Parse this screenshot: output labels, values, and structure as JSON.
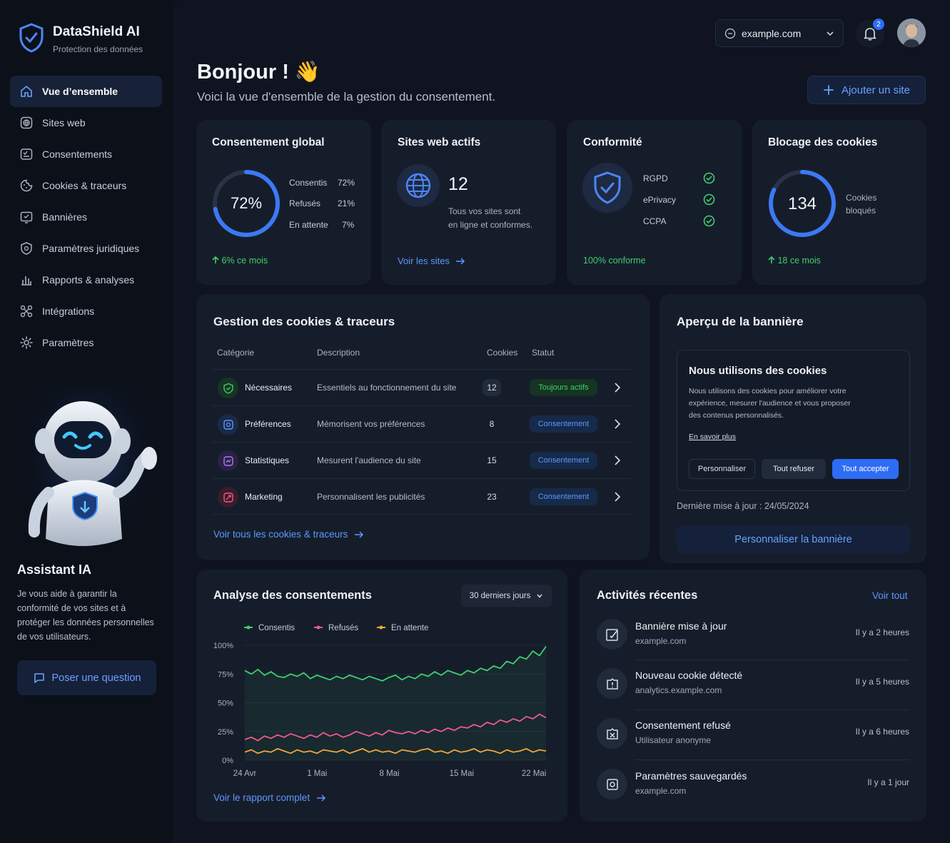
{
  "app": {
    "name": "DataShield AI",
    "tagline": "Protection des données"
  },
  "nav": [
    {
      "label": "Vue d’ensemble",
      "icon": "home-icon",
      "active": true
    },
    {
      "label": "Sites web",
      "icon": "globe-icon"
    },
    {
      "label": "Consentements",
      "icon": "consent-icon"
    },
    {
      "label": "Cookies & traceurs",
      "icon": "cookie-icon"
    },
    {
      "label": "Bannières",
      "icon": "banner-icon"
    },
    {
      "label": "Paramètres juridiques",
      "icon": "legal-icon"
    },
    {
      "label": "Rapports & analyses",
      "icon": "chart-icon"
    },
    {
      "label": "Intégrations",
      "icon": "integrations-icon"
    },
    {
      "label": "Paramètres",
      "icon": "gear-icon"
    }
  ],
  "assistant": {
    "title": "Assistant IA",
    "text": "Je vous aide à garantir la conformité de vos sites et à protéger les données personnelles de vos utilisateurs.",
    "button": "Poser une question"
  },
  "topbar": {
    "site": "example.com",
    "notifications": "2"
  },
  "greeting": {
    "title": "Bonjour ! 👋",
    "subtitle": "Voici la vue d'ensemble de la gestion du consentement.",
    "add_site": "Ajouter un site"
  },
  "stats": {
    "consent": {
      "title": "Consentement global",
      "value": "72%",
      "fraction": 0.72,
      "rows": [
        {
          "label": "Consentis",
          "value": "72%"
        },
        {
          "label": "Refusés",
          "value": "21%"
        },
        {
          "label": "En attente",
          "value": "7%"
        }
      ],
      "trend": "6% ce mois"
    },
    "sites": {
      "title": "Sites web actifs",
      "value": "12",
      "text1": "Tous vos sites sont",
      "text2": "en ligne et conformes.",
      "link": "Voir les sites"
    },
    "compliance": {
      "title": "Conformité",
      "items": [
        "RGPD",
        "ePrivacy",
        "CCPA"
      ],
      "footer": "100% conforme"
    },
    "blocking": {
      "title": "Blocage des cookies",
      "value": "134",
      "label1": "Cookies",
      "label2": "bloqués",
      "trend": "18 ce mois",
      "fraction": 0.82
    }
  },
  "cookies": {
    "title": "Gestion des cookies & traceurs",
    "headers": {
      "category": "Catégorie",
      "description": "Description",
      "count": "Cookies",
      "status": "Statut"
    },
    "rows": [
      {
        "category": "Nécessaires",
        "description": "Essentiels au fonctionnement du site",
        "count": "12",
        "status": "Toujours actifs",
        "color": "#3ecf6e"
      },
      {
        "category": "Préférences",
        "description": "Mémorisent vos préférences",
        "count": "8",
        "status": "Consentement",
        "color": "#5c98ff"
      },
      {
        "category": "Statistiques",
        "description": "Mesurent l'audience du site",
        "count": "15",
        "status": "Consentement",
        "color": "#a77bf5"
      },
      {
        "category": "Marketing",
        "description": "Personnalisent les publicités",
        "count": "23",
        "status": "Consentement",
        "color": "#f05a8a"
      }
    ],
    "link": "Voir tous les cookies & traceurs"
  },
  "banner": {
    "title": "Aperçu de la bannière",
    "heading": "Nous utilisons des cookies",
    "line1": "Nous utilisons des cookies pour améliorer votre",
    "line2": "expérience, mesurer l'audience et vous proposer",
    "line3": "des contenus personnalisés.",
    "more": "En savoir plus",
    "btn_customize": "Personnaliser",
    "btn_refuse": "Tout refuser",
    "btn_accept": "Tout accepter",
    "updated": "Dernière mise à jour : 24/05/2024",
    "edit": "Personnaliser la bannière"
  },
  "analysis": {
    "title": "Analyse des consentements",
    "period": "30 derniers jours",
    "link": "Voir le rapport complet"
  },
  "chart_data": {
    "type": "line",
    "x": [
      "24 Avr",
      "1 Mai",
      "8 Mai",
      "15 Mai",
      "22 Mai"
    ],
    "ylim": [
      0,
      100
    ],
    "yticks": [
      "100%",
      "75%",
      "50%",
      "25%",
      "0%"
    ],
    "series": [
      {
        "name": "Consentis",
        "color": "#3ecf6e",
        "values": [
          78,
          75,
          79,
          74,
          77,
          73,
          72,
          75,
          73,
          76,
          71,
          74,
          72,
          70,
          73,
          71,
          74,
          72,
          70,
          73,
          71,
          69,
          72,
          74,
          70,
          73,
          71,
          75,
          73,
          77,
          74,
          78,
          76,
          74,
          78,
          76,
          80,
          78,
          82,
          80,
          86,
          84,
          90,
          88,
          95,
          91,
          99
        ]
      },
      {
        "name": "Refusés",
        "color": "#f05a8a",
        "values": [
          18,
          20,
          17,
          21,
          19,
          22,
          20,
          23,
          21,
          19,
          22,
          20,
          24,
          21,
          23,
          20,
          22,
          25,
          23,
          21,
          24,
          22,
          26,
          24,
          23,
          25,
          23,
          26,
          24,
          27,
          25,
          28,
          26,
          29,
          28,
          31,
          29,
          33,
          31,
          35,
          33,
          36,
          34,
          38,
          36,
          40,
          37
        ]
      },
      {
        "name": "En attente",
        "color": "#f0a63c",
        "values": [
          7,
          9,
          6,
          8,
          7,
          10,
          8,
          6,
          9,
          7,
          8,
          6,
          9,
          8,
          7,
          9,
          6,
          8,
          10,
          7,
          9,
          7,
          8,
          6,
          9,
          8,
          7,
          9,
          10,
          7,
          8,
          6,
          9,
          7,
          8,
          10,
          7,
          9,
          8,
          6,
          9,
          7,
          8,
          10,
          7,
          9,
          8
        ]
      }
    ]
  },
  "activities": {
    "title": "Activités récentes",
    "all": "Voir tout",
    "items": [
      {
        "title": "Bannière mise à jour",
        "sub": "example.com",
        "time": "Il y a 2 heures",
        "icon": "edit-icon"
      },
      {
        "title": "Nouveau cookie détecté",
        "sub": "analytics.example.com",
        "time": "Il y a 5 heures",
        "icon": "cookie-alert-icon"
      },
      {
        "title": "Consentement refusé",
        "sub": "Utilisateur anonyme",
        "time": "Il y a 6 heures",
        "icon": "refused-icon"
      },
      {
        "title": "Paramètres sauvegardés",
        "sub": "example.com",
        "time": "Il y a 1 jour",
        "icon": "settings-saved-icon"
      }
    ]
  }
}
